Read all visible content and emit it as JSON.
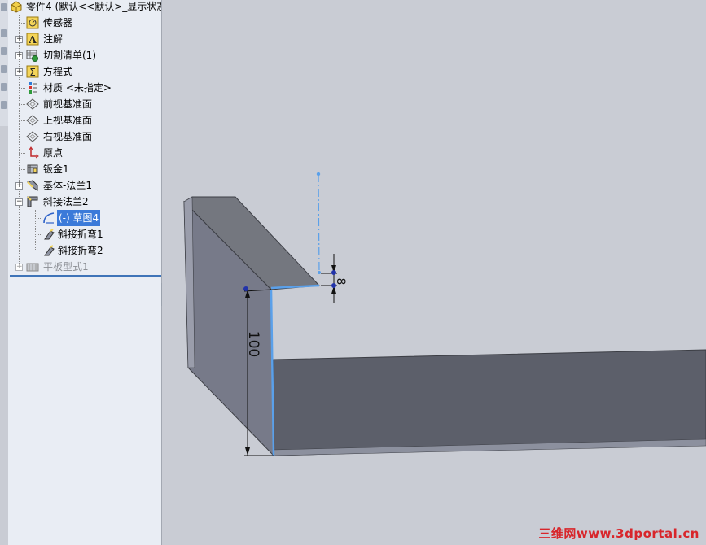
{
  "tree": {
    "root_label": "零件4 (默认<<默认>_显示状态",
    "items": [
      {
        "label": "传感器",
        "icon": "sensor-icon"
      },
      {
        "label": "注解",
        "icon": "annotation-icon"
      },
      {
        "label": "切割清单(1)",
        "icon": "cut-list-icon"
      },
      {
        "label": "方程式",
        "icon": "equation-icon"
      },
      {
        "label": "材质 <未指定>",
        "icon": "material-icon"
      },
      {
        "label": "前视基准面",
        "icon": "plane-icon"
      },
      {
        "label": "上视基准面",
        "icon": "plane-icon"
      },
      {
        "label": "右视基准面",
        "icon": "plane-icon"
      },
      {
        "label": "原点",
        "icon": "origin-icon"
      },
      {
        "label": "钣金1",
        "icon": "sheet-metal-icon"
      },
      {
        "label": "基体-法兰1",
        "icon": "base-flange-icon"
      },
      {
        "label": "斜接法兰2",
        "icon": "miter-flange-icon"
      },
      {
        "label": "(-) 草图4",
        "icon": "sketch-icon"
      },
      {
        "label": "斜接折弯1",
        "icon": "miter-bend-icon"
      },
      {
        "label": "斜接折弯2",
        "icon": "miter-bend-icon"
      },
      {
        "label": "平板型式1",
        "icon": "flat-pattern-icon"
      }
    ]
  },
  "viewport": {
    "dimensions": {
      "height": "100",
      "thickness": "8"
    }
  },
  "watermark": "三维网www.3dportal.cn",
  "colors": {
    "accent": "#3b7ad9",
    "panel": "#e9edf4",
    "viewport": "#c9ccd4",
    "sketch": "#5aa0ea",
    "model_face": "#7b7e8c"
  }
}
